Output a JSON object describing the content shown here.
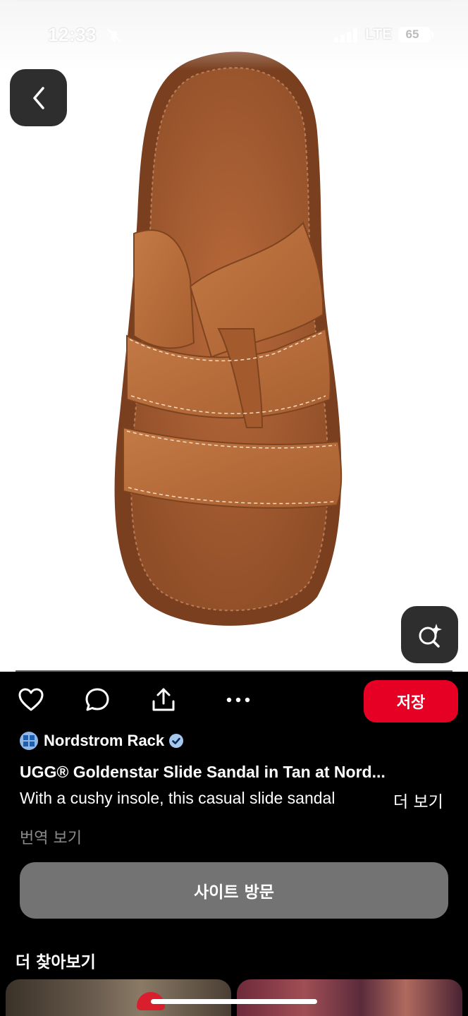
{
  "status_bar": {
    "time": "12:33",
    "network": "LTE",
    "battery": "65"
  },
  "pin": {
    "source_name": "Nordstrom Rack",
    "title": "UGG® Goldenstar Slide Sandal in Tan at Nord...",
    "description": "With a cushy insole, this casual slide sandal",
    "more_label": "더 보기",
    "translate_label": "번역 보기"
  },
  "actions": {
    "save_label": "저장",
    "visit_label": "사이트 방문"
  },
  "more_section": {
    "title": "더 찾아보기"
  },
  "colors": {
    "save_red": "#e60023",
    "visit_gray": "#737373",
    "leather": "#b56a3a"
  },
  "icons": [
    "back-chevron-icon",
    "visual-search-icon",
    "heart-icon",
    "comment-icon",
    "share-icon",
    "more-icon",
    "verified-icon",
    "bell-off-icon",
    "signal-icon"
  ]
}
